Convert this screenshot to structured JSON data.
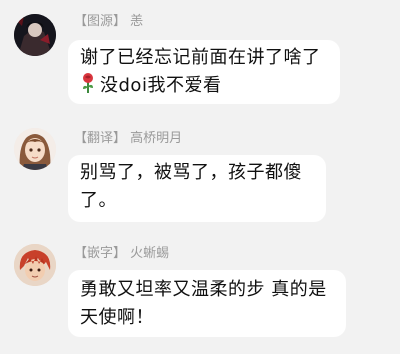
{
  "messages": [
    {
      "sender_tag": "【图源】",
      "sender_name": "恙",
      "lines": [
        "谢了已经忘记前面在讲了啥了",
        "没doi我不爱看"
      ],
      "emoji": "rose-icon"
    },
    {
      "sender_tag": "【翻译】",
      "sender_name": "高桥明月",
      "lines": [
        "别骂了，被骂了，孩子都傻",
        "了。"
      ]
    },
    {
      "sender_tag": "【嵌字】",
      "sender_name": "火蜥蜴",
      "lines": [
        "勇敢又坦率又温柔的步 真的是",
        "天使啊！"
      ]
    }
  ]
}
